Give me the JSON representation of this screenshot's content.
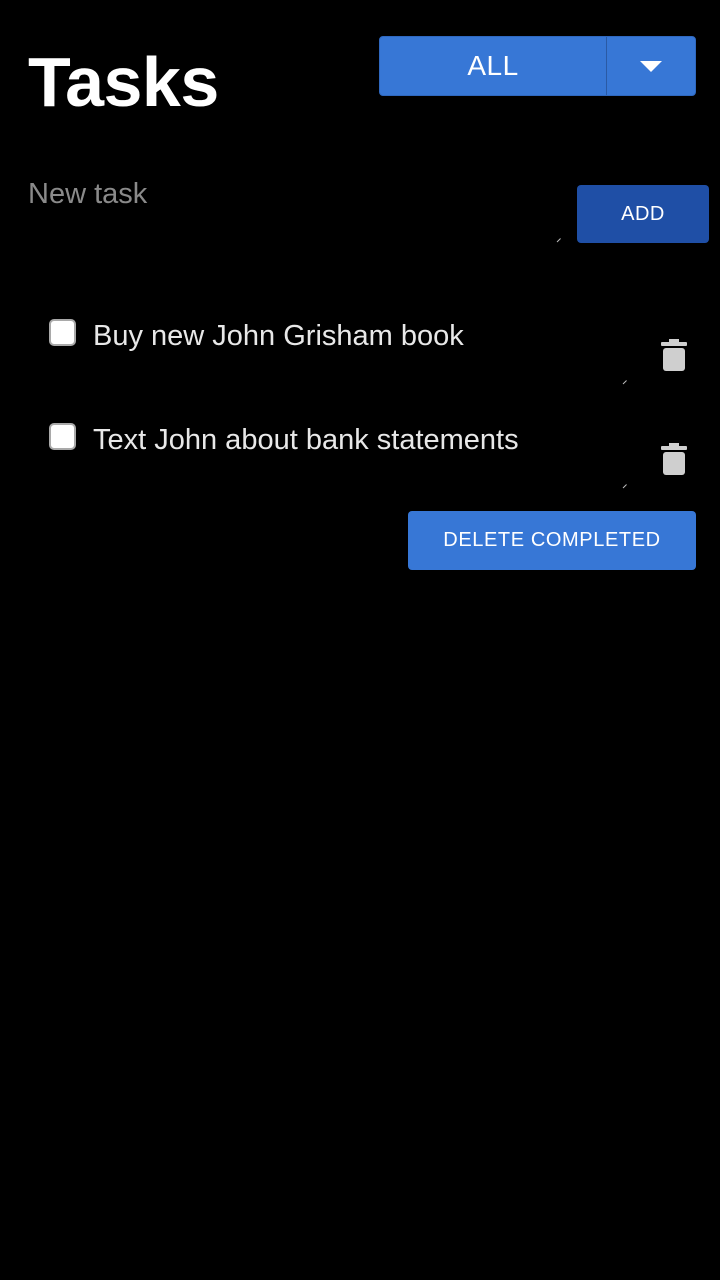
{
  "header": {
    "title": "Tasks"
  },
  "filter": {
    "selected": "ALL",
    "toggle_icon": "caret-down-icon"
  },
  "new_task": {
    "placeholder": "New task",
    "value": "",
    "add_label": "ADD"
  },
  "tasks": [
    {
      "text": "Buy new John Grisham book",
      "completed": false,
      "delete_icon": "trash-icon"
    },
    {
      "text": "Text John about bank statements",
      "completed": false,
      "delete_icon": "trash-icon"
    }
  ],
  "actions": {
    "delete_completed_label": "DELETE COMPLETED"
  },
  "colors": {
    "background": "#000000",
    "primary": "#3777d6",
    "primary_dark": "#1f4fa6",
    "text": "#e8e8e8",
    "placeholder": "#8a8a8a"
  }
}
